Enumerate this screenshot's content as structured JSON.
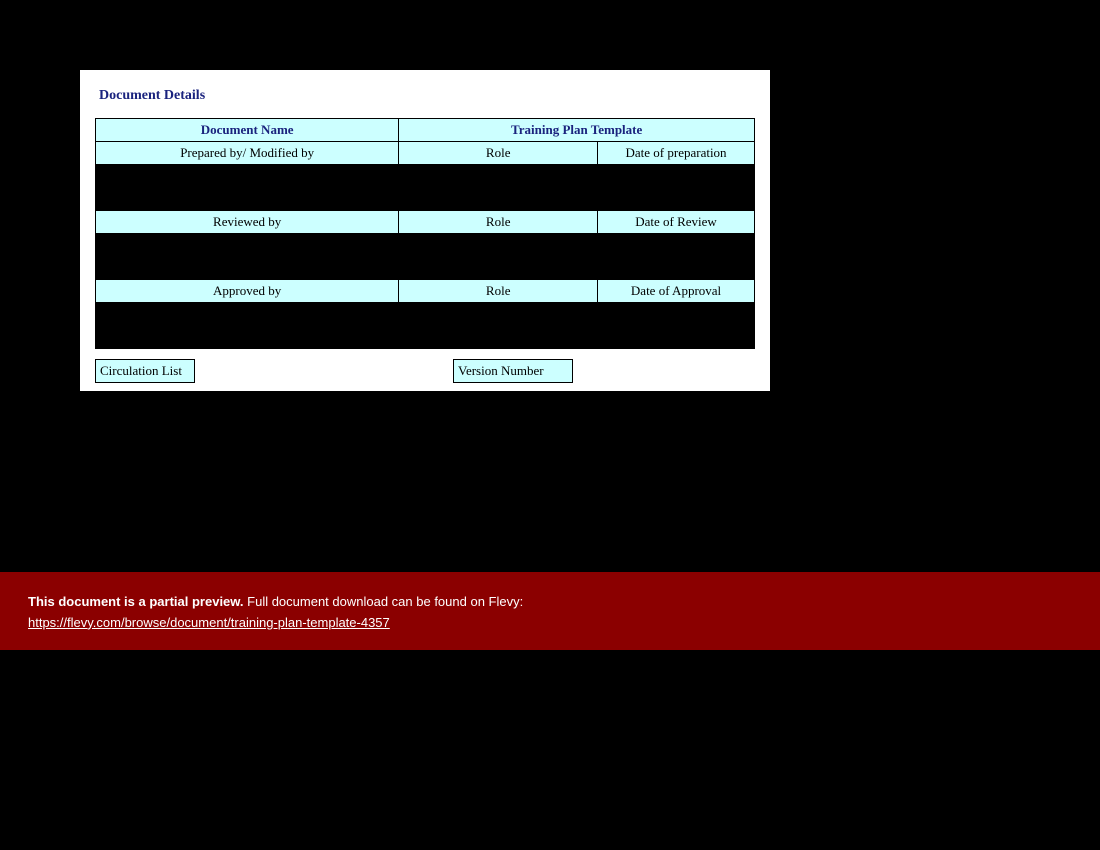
{
  "title": "Document Details",
  "docNameLabel": "Document Name",
  "docNameValue": "Training Plan Template",
  "rows": [
    {
      "c1": "Prepared by/ Modified by",
      "c2": "Role",
      "c3": "Date of preparation"
    },
    {
      "c1": "Reviewed by",
      "c2": "Role",
      "c3": "Date of Review"
    },
    {
      "c1": "Approved by",
      "c2": "Role",
      "c3": "Date of Approval"
    }
  ],
  "circulationLabel": "Circulation List",
  "versionLabel": "Version Number",
  "banner": {
    "bold": "This document is a partial preview.",
    "rest": "  Full document download can be found on Flevy:",
    "link": "https://flevy.com/browse/document/training-plan-template-4357"
  }
}
